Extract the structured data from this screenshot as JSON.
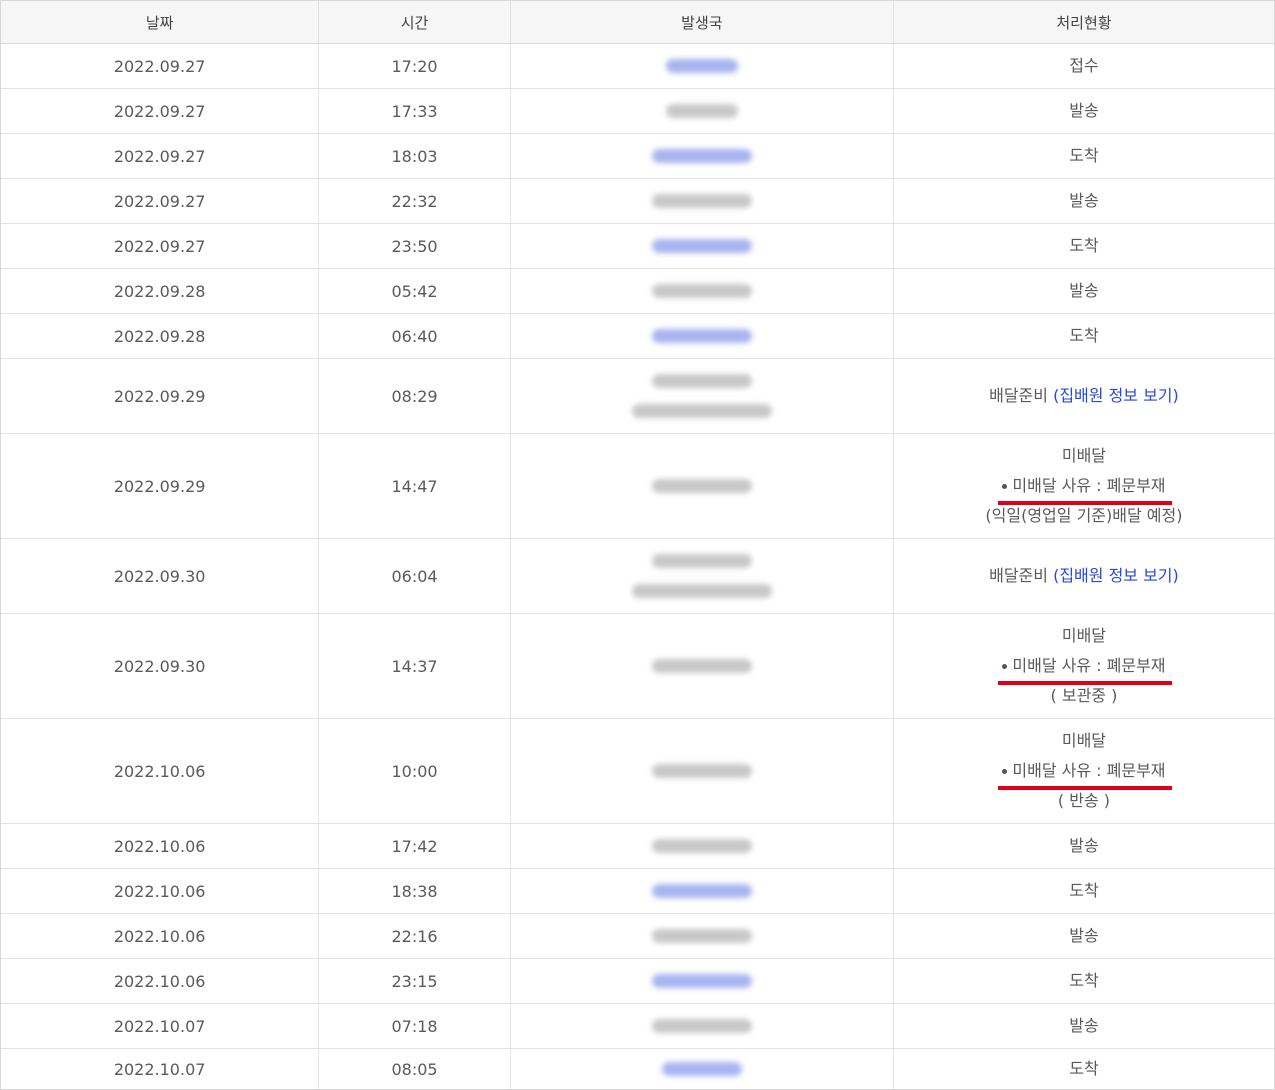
{
  "columns": {
    "date": "날짜",
    "time": "시간",
    "office": "발생국",
    "status": "처리현황"
  },
  "rows": [
    {
      "date": "2022.09.27",
      "time": "17:20",
      "status": "접수"
    },
    {
      "date": "2022.09.27",
      "time": "17:33",
      "status": "발송"
    },
    {
      "date": "2022.09.27",
      "time": "18:03",
      "status": "도착"
    },
    {
      "date": "2022.09.27",
      "time": "22:32",
      "status": "발송"
    },
    {
      "date": "2022.09.27",
      "time": "23:50",
      "status": "도착"
    },
    {
      "date": "2022.09.28",
      "time": "05:42",
      "status": "발송"
    },
    {
      "date": "2022.09.28",
      "time": "06:40",
      "status": "도착"
    },
    {
      "date": "2022.09.29",
      "time": "08:29",
      "status": "배달준비",
      "link": "(집배원 정보 보기)"
    },
    {
      "date": "2022.09.29",
      "time": "14:47",
      "status": "미배달",
      "reason": "미배달 사유 : 폐문부재",
      "note": "(익일(영업일 기준)배달 예정)"
    },
    {
      "date": "2022.09.30",
      "time": "06:04",
      "status": "배달준비",
      "link": "(집배원 정보 보기)"
    },
    {
      "date": "2022.09.30",
      "time": "14:37",
      "status": "미배달",
      "reason": "미배달 사유 : 폐문부재",
      "note": "( 보관중 )"
    },
    {
      "date": "2022.10.06",
      "time": "10:00",
      "status": "미배달",
      "reason": "미배달 사유 : 폐문부재",
      "note": "( 반송 )"
    },
    {
      "date": "2022.10.06",
      "time": "17:42",
      "status": "발송"
    },
    {
      "date": "2022.10.06",
      "time": "18:38",
      "status": "도착"
    },
    {
      "date": "2022.10.06",
      "time": "22:16",
      "status": "발송"
    },
    {
      "date": "2022.10.06",
      "time": "23:15",
      "status": "도착"
    },
    {
      "date": "2022.10.07",
      "time": "07:18",
      "status": "발송"
    },
    {
      "date": "2022.10.07",
      "time": "08:05",
      "status": "도착"
    }
  ],
  "colors": {
    "link": "#2748d8",
    "underline": "#e1001a",
    "redacted_blue": "#a8b4f0",
    "redacted_gray": "#c8c8c8"
  }
}
